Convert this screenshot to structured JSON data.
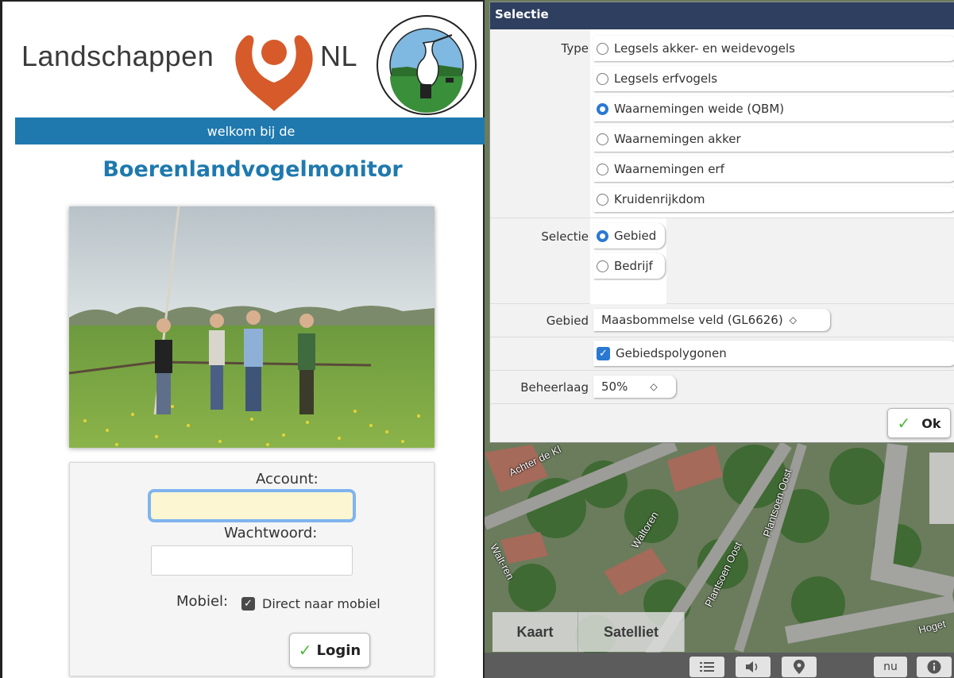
{
  "login_page": {
    "brand_left": "Landschappen",
    "brand_right": "NL",
    "welcome": "welkom bij de",
    "title": "Boerenlandvogelmonitor",
    "account_label": "Account:",
    "account_value": "",
    "password_label": "Wachtwoord:",
    "mobile_label": "Mobiel:",
    "mobile_checkbox_label": "Direct naar mobiel",
    "mobile_checked": true,
    "login_button": "Login"
  },
  "selection_dialog": {
    "title": "Selectie",
    "type_label": "Type",
    "type_options": [
      {
        "label": "Legsels akker- en weidevogels",
        "selected": false
      },
      {
        "label": "Legsels erfvogels",
        "selected": false
      },
      {
        "label": "Waarnemingen weide (QBM)",
        "selected": true
      },
      {
        "label": "Waarnemingen akker",
        "selected": false
      },
      {
        "label": "Waarnemingen erf",
        "selected": false
      },
      {
        "label": "Kruidenrijkdom",
        "selected": false
      }
    ],
    "selectie_label": "Selectie",
    "selectie_options": [
      {
        "label": "Gebied",
        "selected": true
      },
      {
        "label": "Bedrijf",
        "selected": false
      }
    ],
    "gebied_label": "Gebied",
    "gebied_value": "Maasbommelse veld (GL6626)",
    "polygons_label": "Gebiedspolygonen",
    "polygons_checked": true,
    "beheerlaag_label": "Beheerlaag",
    "beheerlaag_value": "50%",
    "ok_button": "Ok"
  },
  "map": {
    "street_labels": [
      "Achter de Kl",
      "Walt-ren",
      "Waltoren",
      "Plantsoen Oost",
      "Plantsoen Oost",
      "Hoget"
    ],
    "map_type_tabs": [
      "Kaart",
      "Satelliet"
    ],
    "bottom_buttons": [
      "list-icon",
      "speaker-icon",
      "location-pin-icon"
    ],
    "nu_button": "nu",
    "info_icon": "info-icon"
  },
  "colors": {
    "brand_blue": "#1f79ae",
    "dialog_header": "#2e3f5f",
    "radio_blue": "#2a78d2",
    "check_green": "#4fb83a",
    "logo_orange": "#d65a2a"
  }
}
